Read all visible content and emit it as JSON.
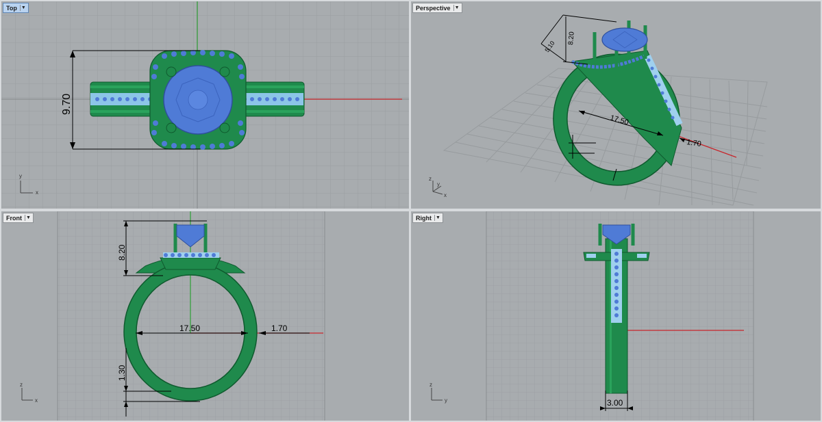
{
  "viewports": {
    "top": {
      "title": "Top",
      "active": true,
      "axis_a": "y",
      "axis_b": "x"
    },
    "perspective": {
      "title": "Perspective",
      "active": false,
      "axis_a": "z",
      "axis_b": "y",
      "axis_c": "x"
    },
    "front": {
      "title": "Front",
      "active": false,
      "axis_a": "z",
      "axis_b": "x"
    },
    "right": {
      "title": "Right",
      "active": false,
      "axis_a": "z",
      "axis_b": "y"
    }
  },
  "dimensions": {
    "top_height": "9.70",
    "persp_height": "8.20",
    "persp_width": "5.10",
    "persp_diameter": "17.50",
    "persp_band": "1.70",
    "front_height": "8.20",
    "front_diameter": "17.50",
    "front_band": "1.70",
    "front_bottom": "1.30",
    "right_width": "3.00"
  },
  "colors": {
    "viewport_bg": "#a8acaf",
    "grid_minor": "#9a9ea1",
    "grid_major": "#8a8e91",
    "ring_green": "#1f8a4c",
    "gem_blue": "#4f7bd6",
    "melee_light": "#9fd0ee",
    "axis_x": "#c8242a",
    "axis_y": "#2e9e35"
  },
  "icons": {
    "viewport_menu": "chevron-down-icon",
    "axis_gizmo": "axis-icon"
  }
}
